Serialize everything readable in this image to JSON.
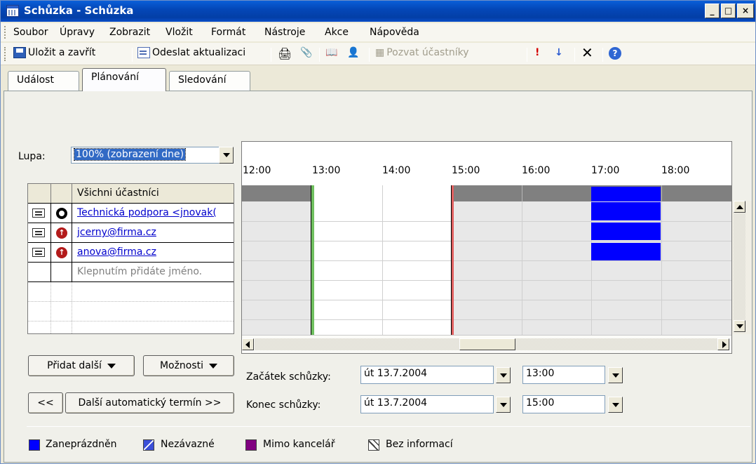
{
  "window": {
    "title": "Schůzka - Schůzka"
  },
  "menu": [
    {
      "label": "Soubor"
    },
    {
      "label": "Úpravy"
    },
    {
      "label": "Zobrazit"
    },
    {
      "label": "Vložit"
    },
    {
      "label": "Formát"
    },
    {
      "label": "Nástroje"
    },
    {
      "label": "Akce"
    },
    {
      "label": "Nápověda"
    }
  ],
  "toolbar": {
    "save_close": "Uložit a zavřít",
    "send_update": "Odeslat aktualizaci",
    "invite": "Pozvat účastníky"
  },
  "tabs": [
    {
      "label": "Událost"
    },
    {
      "label": "Plánování"
    },
    {
      "label": "Sledování"
    }
  ],
  "zoom": {
    "label": "Lupa:",
    "value": "100% (zobrazení dne)"
  },
  "attendees": {
    "header": "Všichni účastníci",
    "rows": [
      {
        "name": "Technická podpora <jnovak("
      },
      {
        "name": "jcerny@firma.cz"
      },
      {
        "name": "anova@firma.cz"
      }
    ],
    "add_hint": "Klepnutím přidáte jméno."
  },
  "schedule": {
    "hours": [
      "12:00",
      "13:00",
      "14:00",
      "15:00",
      "16:00",
      "17:00",
      "18:00"
    ]
  },
  "buttons": {
    "add_more": "Přidat další",
    "options": "Možnosti",
    "prev": "<<",
    "next_auto": "Další automatický termín >>"
  },
  "meeting": {
    "start_label": "Začátek schůzky:",
    "start_date": "út 13.7.2004",
    "start_time": "13:00",
    "end_label": "Konec schůzky:",
    "end_date": "út 13.7.2004",
    "end_time": "15:00"
  },
  "legend": [
    {
      "label": "Zaneprázdněn",
      "color": "#0000ff"
    },
    {
      "label": "Nezávazné",
      "color": "#3b4fd8"
    },
    {
      "label": "Mimo kancelář",
      "color": "#800080"
    },
    {
      "label": "Bez informací",
      "color": "#ffffff"
    }
  ],
  "colors": {
    "busy": "#0000ff",
    "start_line": "#5cb85c",
    "end_line": "#d9534f"
  }
}
